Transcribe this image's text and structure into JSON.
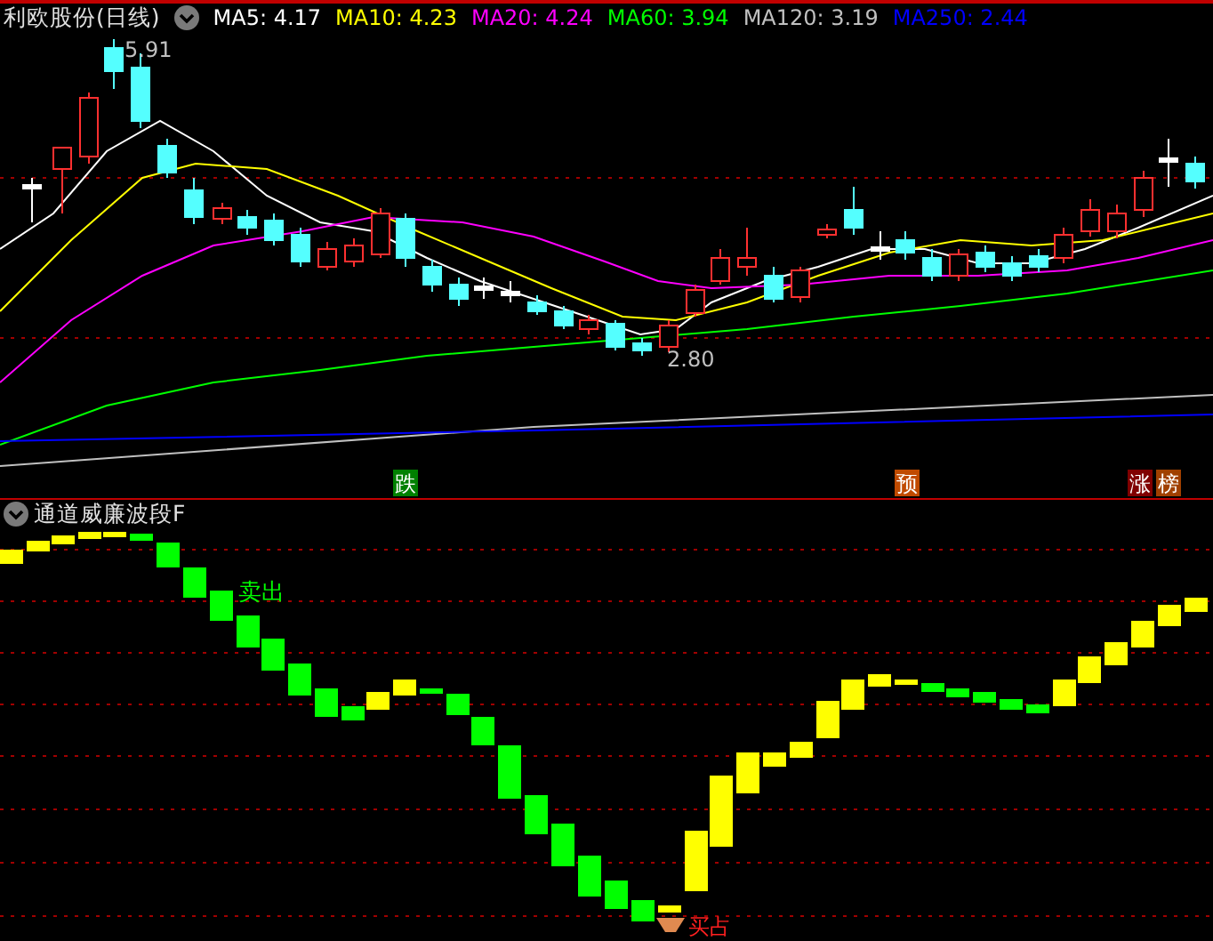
{
  "header": {
    "title": "利欧股份(日线)",
    "indicators": [
      {
        "label": "MA5: 4.17",
        "color": "#ffffff"
      },
      {
        "label": "MA10: 4.23",
        "color": "#ffff00"
      },
      {
        "label": "MA20: 4.24",
        "color": "#ff00ff"
      },
      {
        "label": "MA60: 3.94",
        "color": "#00ff00"
      },
      {
        "label": "MA120: 3.19",
        "color": "#c0c0c0"
      },
      {
        "label": "MA250: 2.44",
        "color": "#0000ff"
      }
    ]
  },
  "main_chart": {
    "high_label": "5.91",
    "low_label": "2.80",
    "markers": [
      {
        "text": "跌",
        "color": "#008000"
      },
      {
        "text": "预",
        "color": "#c04a00"
      },
      {
        "text": "涨",
        "color": "#800000"
      },
      {
        "text": "榜",
        "color": "#a04000"
      }
    ]
  },
  "indicator_panel": {
    "title": "通道威廉波段F",
    "sell_label": "卖出",
    "buy_label": "买占"
  }
}
